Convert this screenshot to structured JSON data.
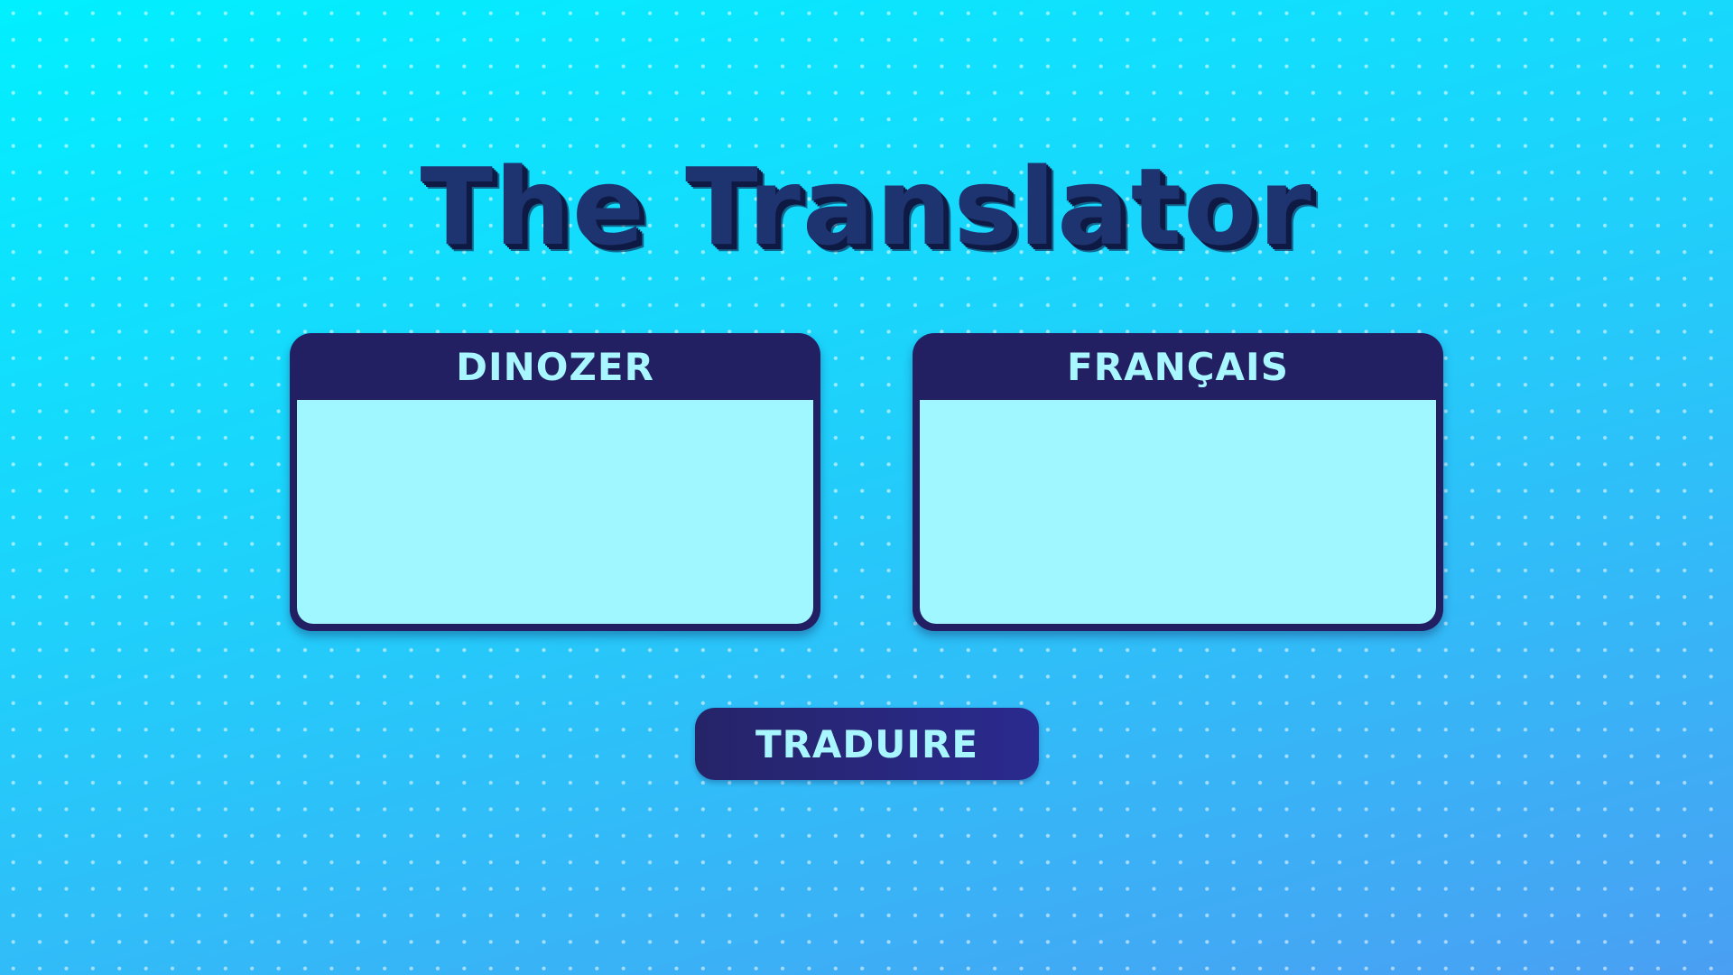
{
  "app": {
    "title": "The Translator"
  },
  "panels": {
    "source": {
      "label": "DINOZER",
      "value": ""
    },
    "target": {
      "label": "FRANÇAIS",
      "value": ""
    }
  },
  "actions": {
    "translate_label": "TRADUIRE"
  },
  "colors": {
    "background_top": "#00f0ff",
    "background_bottom": "#4a9ff3",
    "panel_frame": "#231f63",
    "panel_field": "#a0f7ff",
    "label_text": "#a8f6ff",
    "title_text": "#1e3470"
  }
}
